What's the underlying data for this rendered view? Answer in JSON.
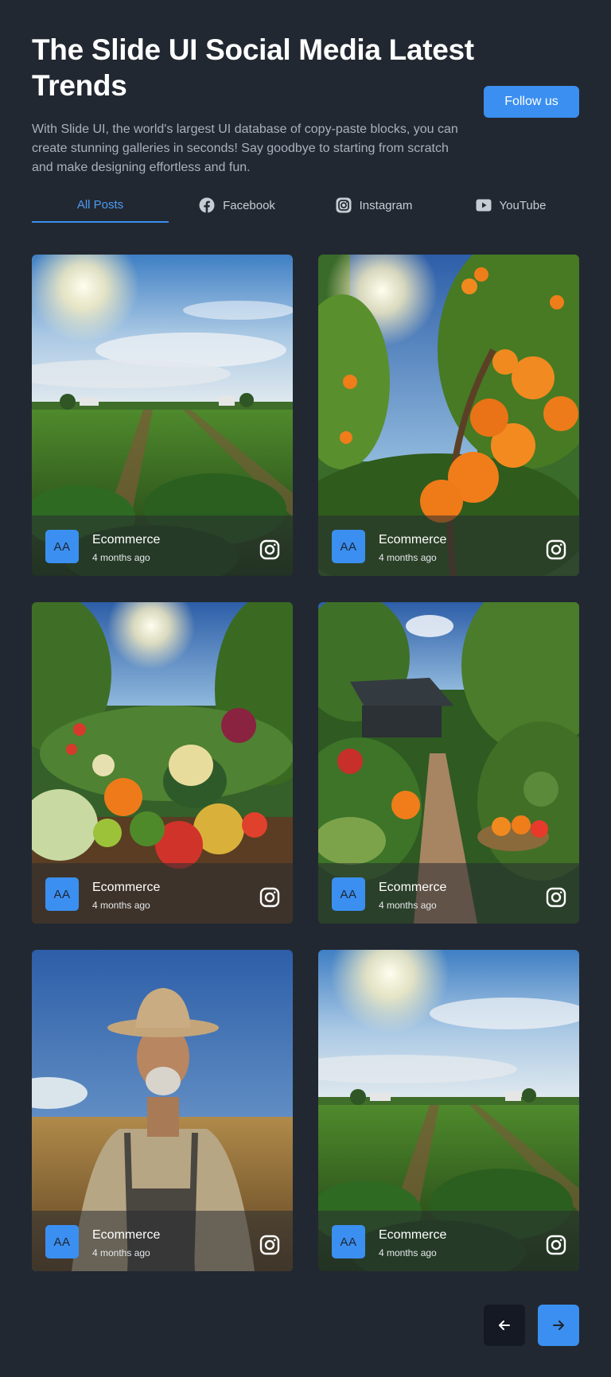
{
  "header": {
    "title": "The Slide UI Social Media Latest Trends",
    "description": "With Slide UI, the world's largest UI database of copy-paste blocks, you can create stunning galleries in seconds! Say goodbye to starting from scratch and make designing effortless and fun.",
    "follow_label": "Follow us"
  },
  "tabs": [
    {
      "label": "All Posts",
      "icon": null
    },
    {
      "label": "Facebook",
      "icon": "facebook-icon"
    },
    {
      "label": "Instagram",
      "icon": "instagram-icon"
    },
    {
      "label": "YouTube",
      "icon": "youtube-icon"
    }
  ],
  "posts": [
    {
      "image": "crop-field-sky",
      "avatar": "AA",
      "author": "Ecommerce",
      "time": "4 months ago",
      "platform_icon": "instagram-icon"
    },
    {
      "image": "orange-tree",
      "avatar": "AA",
      "author": "Ecommerce",
      "time": "4 months ago",
      "platform_icon": "instagram-icon"
    },
    {
      "image": "vegetable-harvest",
      "avatar": "AA",
      "author": "Ecommerce",
      "time": "4 months ago",
      "platform_icon": "instagram-icon"
    },
    {
      "image": "garden-path",
      "avatar": "AA",
      "author": "Ecommerce",
      "time": "4 months ago",
      "platform_icon": "instagram-icon"
    },
    {
      "image": "farmer-portrait",
      "avatar": "AA",
      "author": "Ecommerce",
      "time": "4 months ago",
      "platform_icon": "instagram-icon"
    },
    {
      "image": "crop-field-sky",
      "avatar": "AA",
      "author": "Ecommerce",
      "time": "4 months ago",
      "platform_icon": "instagram-icon"
    }
  ],
  "pagination": {
    "prev_icon": "arrow-left-icon",
    "next_icon": "arrow-right-icon"
  },
  "colors": {
    "background": "#222831",
    "accent": "#3b8ff0",
    "muted_text": "#a9b1bd",
    "prev_button": "#141923"
  }
}
